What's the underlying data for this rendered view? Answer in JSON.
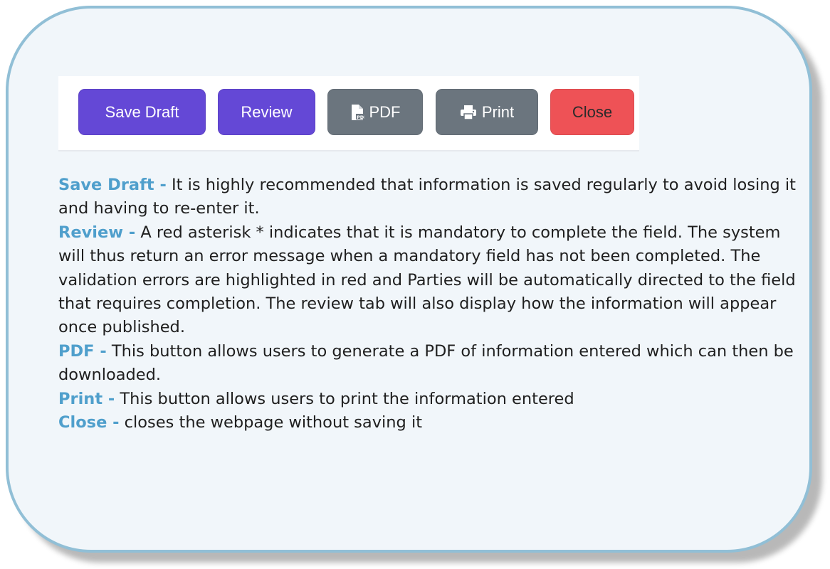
{
  "toolbar": {
    "buttons": [
      {
        "label": "Save Draft",
        "icon": null,
        "color": "#6448d6"
      },
      {
        "label": "Review",
        "icon": null,
        "color": "#6448d6"
      },
      {
        "label": "PDF",
        "icon": "pdf-file-icon",
        "color": "#6b757e"
      },
      {
        "label": "Print",
        "icon": "printer-icon",
        "color": "#6b757e"
      },
      {
        "label": "Close",
        "icon": null,
        "color": "#ee5256"
      }
    ]
  },
  "descriptions": [
    {
      "term": "Save Draft -",
      "text": " It is highly recommended that information is saved regularly to avoid losing it and having to re-enter it."
    },
    {
      "term": "Review -",
      "text": " A red asterisk * indicates that it is mandatory to complete the field.  The system will thus return an error message when a mandatory field has not been completed. The validation errors are highlighted in red and Parties will be automatically directed to the field that requires completion. The review tab will also display how the information will appear once published."
    },
    {
      "term": "PDF -",
      "text": " This button allows users to generate a PDF of information entered which can then be downloaded."
    },
    {
      "term": "Print -",
      "text": " This button allows users to print the information entered"
    },
    {
      "term": "Close -",
      "text": " closes the webpage without saving it"
    }
  ],
  "colors": {
    "term": "#4f9fcc",
    "panel_background": "#f1f6fa",
    "panel_border": "#91bfd6"
  }
}
